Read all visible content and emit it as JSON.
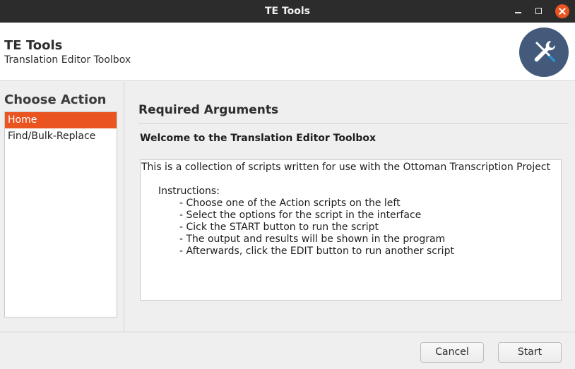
{
  "window": {
    "title": "TE Tools"
  },
  "header": {
    "app_name": "TE Tools",
    "subtitle": "Translation Editor Toolbox",
    "logo_icon": "tools-icon",
    "logo_bg": "#435a7a"
  },
  "sidebar": {
    "title": "Choose Action",
    "items": [
      {
        "label": "Home",
        "selected": true
      },
      {
        "label": "Find/Bulk-Replace",
        "selected": false
      }
    ]
  },
  "main": {
    "section_title": "Required Arguments",
    "welcome": "Welcome to the Translation Editor Toolbox",
    "intro": "This is a collection of scripts written for use with the Ottoman Transcription Project",
    "instructions_heading": "Instructions:",
    "instructions": [
      "- Choose one of the Action scripts on the left",
      "- Select the options for the script in the interface",
      "- Cick the START button to run the script",
      "- The output and results will be shown in the program",
      "- Afterwards, click the EDIT button to run another script"
    ]
  },
  "footer": {
    "cancel_label": "Cancel",
    "start_label": "Start"
  },
  "colors": {
    "accent": "#e95420",
    "titlebar": "#2c2c2c"
  }
}
